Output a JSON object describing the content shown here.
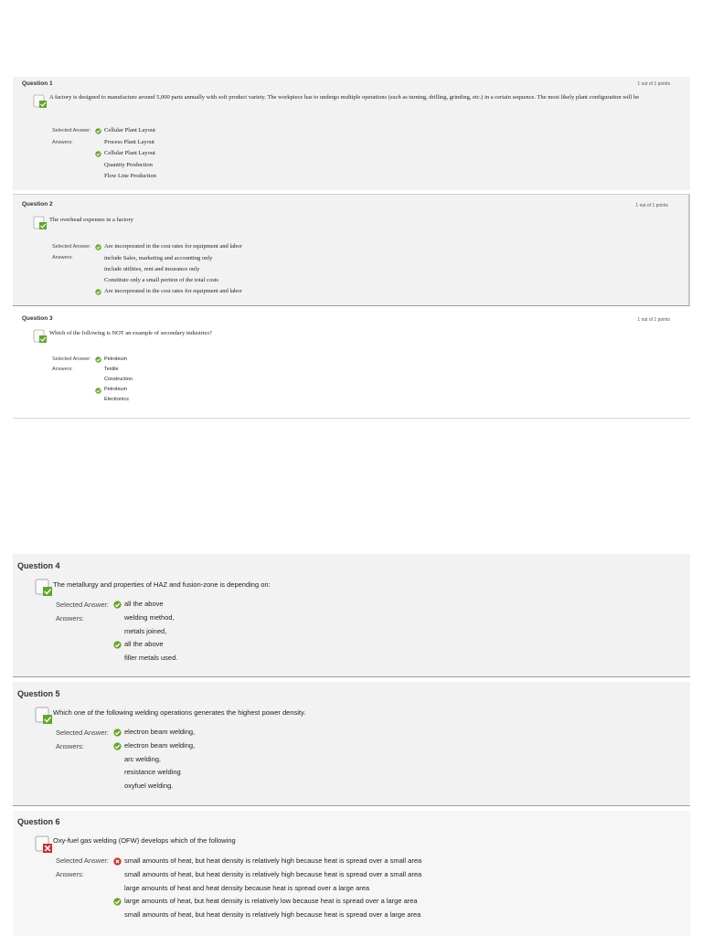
{
  "page1": {
    "questions": [
      {
        "title": "Question 1",
        "points": "1 out of 1 points",
        "text": "A factory is designed to manufacture around 5,000 parts annually with soft product variety. The workpiece has to undergo multiple operations (such as turning, drilling, grinding, etc.) in a certain sequence. The most likely plant configuration will be",
        "selected_label": "Selected Answer:",
        "answers_label": "Answers:",
        "selected_answer": "Cellular Plant Layout",
        "answers": [
          "Process Plant Layout",
          "Cellular Plant Layout",
          "Quantity Production",
          "Flow Line Production"
        ],
        "correct_index": 1
      },
      {
        "title": "Question 2",
        "points": "1 out of 1 points",
        "text": "The overhead expenses in a factory",
        "selected_label": "Selected Answer:",
        "answers_label": "Answers:",
        "selected_answer": "Are incorporated in the cost rates for equipment and labor",
        "answers": [
          "include Sales, marketing and accounting only",
          "include utilities, rent and insurance only",
          "Constitute only a small portion of the total costs",
          "Are incorporated in the cost rates for equipment and labor"
        ],
        "correct_index": 3
      },
      {
        "title": "Question 3",
        "points": "1 out of 1 points",
        "text": "Which of the following is NOT an example of secondary industries?",
        "selected_label": "Selected Answer:",
        "answers_label": "Answers:",
        "selected_answer": "Petroleum",
        "answers": [
          "Textile",
          "Construction",
          "Petroleum",
          "Electronics"
        ],
        "correct_index": 2
      }
    ]
  },
  "page2": {
    "questions": [
      {
        "title": "Question 4",
        "text": "The metallurgy and properties of HAZ and fusion-zone is depending on:",
        "selected_label": "Selected Answer:",
        "answers_label": "Answers:",
        "selected_answer": "all the above",
        "answers": [
          "welding method,",
          "metals joined,",
          "all the above",
          "filler metals used."
        ],
        "correct_index": 2,
        "status": "correct"
      },
      {
        "title": "Question 5",
        "text": "Which one of the following welding operations generates the highest power density.",
        "selected_label": "Selected Answer:",
        "answers_label": "Answers:",
        "selected_answer": "electron beam welding,",
        "answers": [
          "electron beam welding,",
          "arc welding,",
          "resistance welding",
          "oxyfuel welding."
        ],
        "correct_index": 0,
        "status": "correct"
      },
      {
        "title": "Question 6",
        "text": "Oxy-fuel gas welding (OFW) develops which of the following",
        "selected_label": "Selected Answer:",
        "answers_label": "Answers:",
        "selected_answer": "small amounts of heat, but heat density is relatively high because heat is spread over a small area",
        "answers": [
          "small amounts of heat, but heat density is relatively high because heat is spread over a small area",
          "large amounts of heat and heat density because heat is spread over a large area",
          "large amounts of heat, but heat density is relatively low because heat is spread over a large area",
          "small amounts of heat, but heat density is relatively high because heat is spread over a large area"
        ],
        "correct_index": 2,
        "status": "incorrect"
      }
    ]
  },
  "icons": {
    "correct": "check-circle-icon",
    "incorrect": "x-circle-icon",
    "question_status": "document-status-icon"
  },
  "colors": {
    "correct": "#6aa628",
    "incorrect": "#c9302c",
    "panel_grey": "#f2f2f2"
  }
}
